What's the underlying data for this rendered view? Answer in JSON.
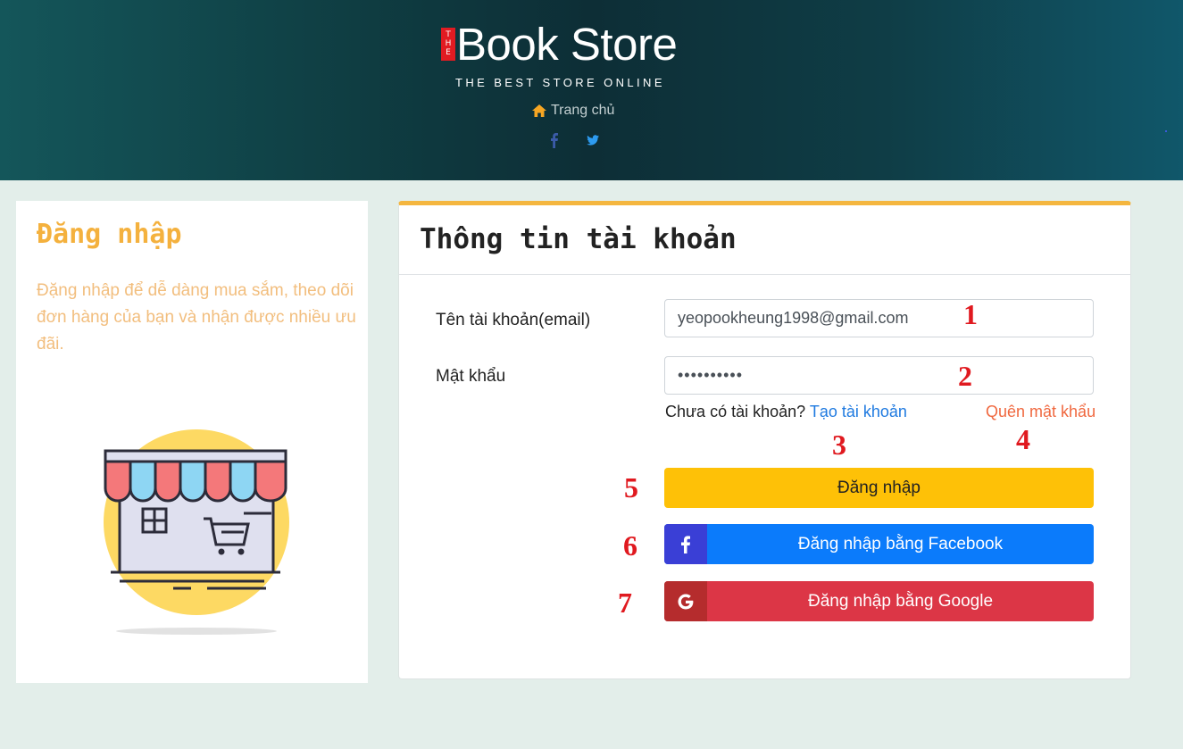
{
  "header": {
    "brand_the": "THE",
    "brand_name": "Book Store",
    "tagline": "THE BEST STORE ONLINE",
    "home_label": "Trang chủ",
    "icons": [
      "home-icon",
      "facebook-icon",
      "twitter-icon"
    ]
  },
  "left_panel": {
    "title": "Đăng nhập",
    "description": "Đặng nhập để dễ dàng mua sắm, theo dõi đơn hàng của bạn và nhận được nhiều ưu đãi."
  },
  "account_form": {
    "title": "Thông tin tài khoản",
    "username_label": "Tên tài khoản(email)",
    "username_value": "yeopookheung1998@gmail.com",
    "password_label": "Mật khẩu",
    "password_value": "••••••••••",
    "no_account_text": "Chưa có tài khoản?",
    "create_account_link": "Tạo tài khoản",
    "forgot_password_link": "Quên mật khẩu",
    "login_button": "Đăng nhập",
    "facebook_button": "Đăng nhập bằng Facebook",
    "google_button": "Đăng nhập bằng Google"
  },
  "annotations": [
    "1",
    "2",
    "3",
    "4",
    "5",
    "6",
    "7"
  ],
  "colors": {
    "accent_yellow": "#fec107",
    "facebook_blue": "#0b7bfb",
    "google_red": "#dc3646",
    "link_blue": "#1f7ae0",
    "forgot_orange": "#f0683f",
    "annotation_red": "#e0191f"
  }
}
